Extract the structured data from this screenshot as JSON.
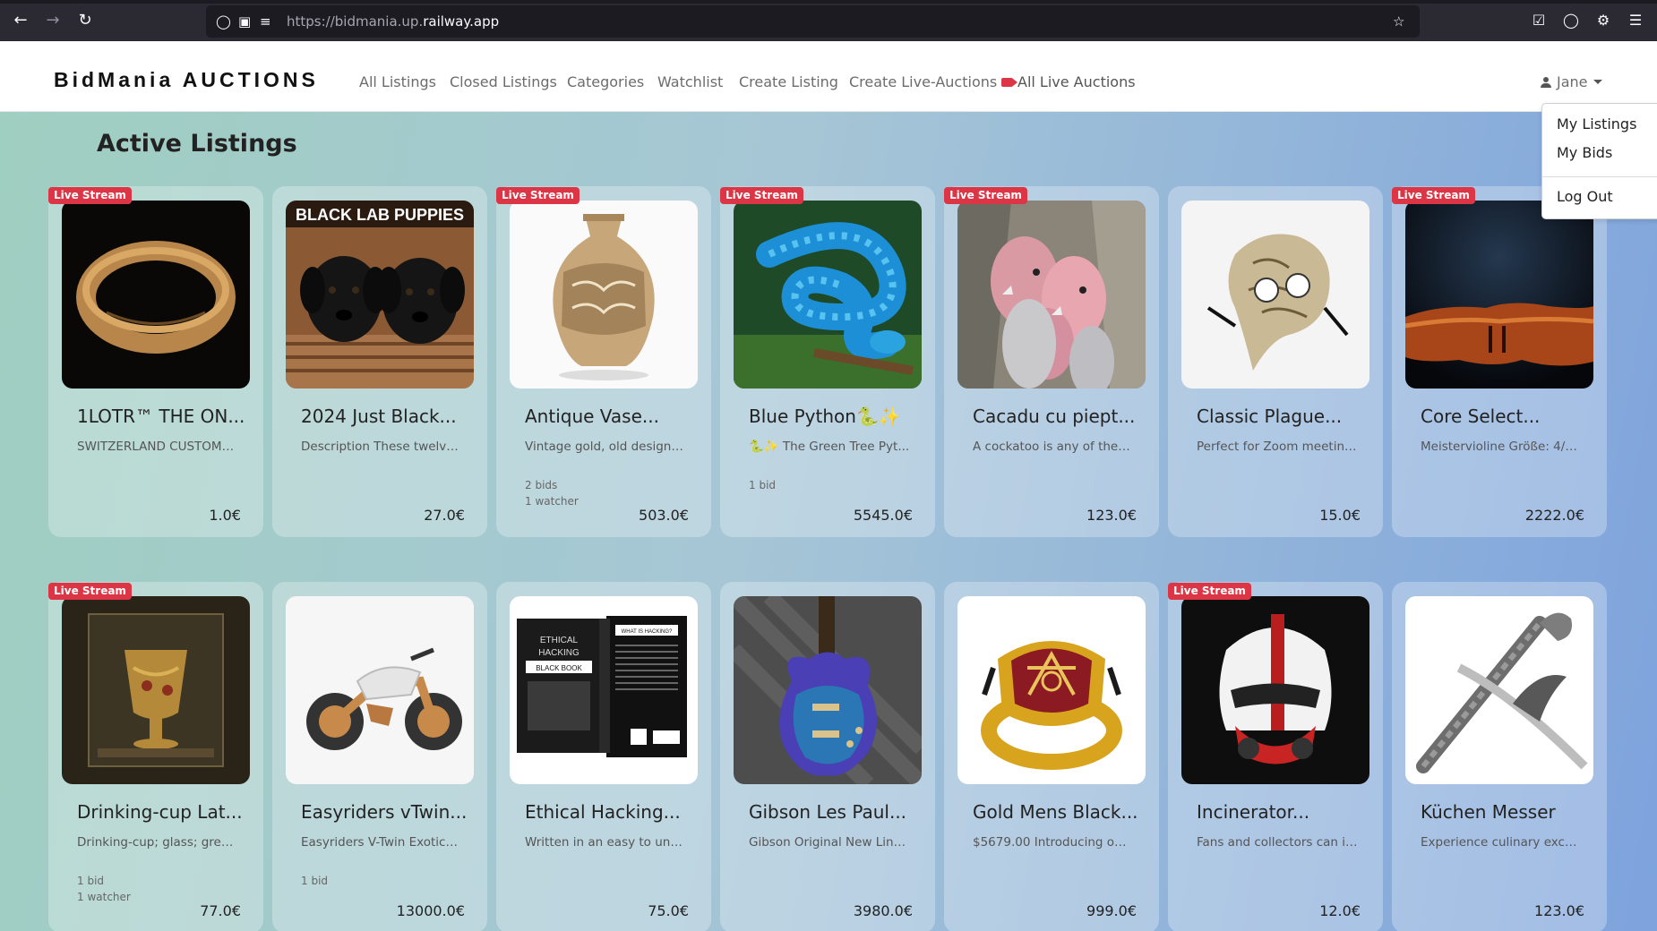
{
  "browser": {
    "url_prefix": "https://bidmania.up.",
    "url_host": "railway.app",
    "icons": [
      "back-arrow-icon",
      "forward-arrow-icon",
      "reload-icon",
      "shield-icon",
      "lock-icon",
      "site-settings-icon",
      "star-icon",
      "pocket-icon",
      "account-icon",
      "extensions-icon",
      "menu-icon"
    ]
  },
  "navbar": {
    "brand": "BidMania AUCTIONS",
    "links": [
      "All Listings",
      "Closed Listings",
      "Categories",
      "Watchlist",
      "Create Listing",
      "Create Live-Auctions",
      "All Live Auctions"
    ],
    "user": "Jane"
  },
  "dropdown": {
    "items": [
      "My Listings",
      "My Bids",
      "Log Out"
    ]
  },
  "main": {
    "title": "Active Listings",
    "badge_label": "Live Stream",
    "listings": [
      {
        "title": "1LOTR™ THE ON...",
        "desc": "SWITZERLAND CUSTOME...",
        "stats": [
          "",
          ""
        ],
        "price": "1.0€",
        "live": true
      },
      {
        "title": "2024 Just Black...",
        "desc": "Description These twelve ...",
        "stats": [
          "",
          ""
        ],
        "price": "27.0€",
        "live": false
      },
      {
        "title": "Antique Vase...",
        "desc": "Vintage gold, old design A...",
        "stats": [
          "2 bids",
          "1 watcher"
        ],
        "price": "503.0€",
        "live": true
      },
      {
        "title": "Blue Python🐍✨",
        "desc": "🐍✨ The Green Tree Pyt...",
        "stats": [
          "1 bid",
          ""
        ],
        "price": "5545.0€",
        "live": true
      },
      {
        "title": "Cacadu cu piept...",
        "desc": "A cockatoo is any of the 2...",
        "stats": [
          "",
          ""
        ],
        "price": "123.0€",
        "live": true
      },
      {
        "title": "Classic Plague...",
        "desc": "Perfect for Zoom meetings",
        "stats": [
          "",
          ""
        ],
        "price": "15.0€",
        "live": false
      },
      {
        "title": "Core Select...",
        "desc": "Meistervioline Größe: 4/4 ...",
        "stats": [
          "",
          ""
        ],
        "price": "2222.0€",
        "live": true
      },
      {
        "title": "Drinking-cup Lat...",
        "desc": "Drinking-cup; glass; green ...",
        "stats": [
          "1 bid",
          "1 watcher"
        ],
        "price": "77.0€",
        "live": true
      },
      {
        "title": "Easyriders vTwin...",
        "desc": "Easyriders V-Twin Exotica i...",
        "stats": [
          "1 bid",
          ""
        ],
        "price": "13000.0€",
        "live": false
      },
      {
        "title": "Ethical Hacking...",
        "desc": "Written in an easy to unde...",
        "stats": [
          "",
          ""
        ],
        "price": "75.0€",
        "live": false
      },
      {
        "title": "Gibson Les Paul...",
        "desc": "Gibson Original New Line-...",
        "stats": [
          "",
          ""
        ],
        "price": "3980.0€",
        "live": false
      },
      {
        "title": "Gold Mens Black...",
        "desc": "$5679.00 Introducing our ...",
        "stats": [
          "",
          ""
        ],
        "price": "999.0€",
        "live": false
      },
      {
        "title": "Incinerator...",
        "desc": "Fans and collectors can im...",
        "stats": [
          "",
          ""
        ],
        "price": "12.0€",
        "live": true
      },
      {
        "title": "Küchen Messer",
        "desc": "Experience culinary excell...",
        "stats": [
          "",
          ""
        ],
        "price": "123.0€",
        "live": false
      }
    ],
    "image_text": {
      "puppies_banner": "BLACK LAB PUPPIES",
      "book_title": [
        "ETHICAL",
        "HACKING",
        "BLACK BOOK"
      ],
      "book_back": "WHAT IS HACKING?"
    }
  }
}
